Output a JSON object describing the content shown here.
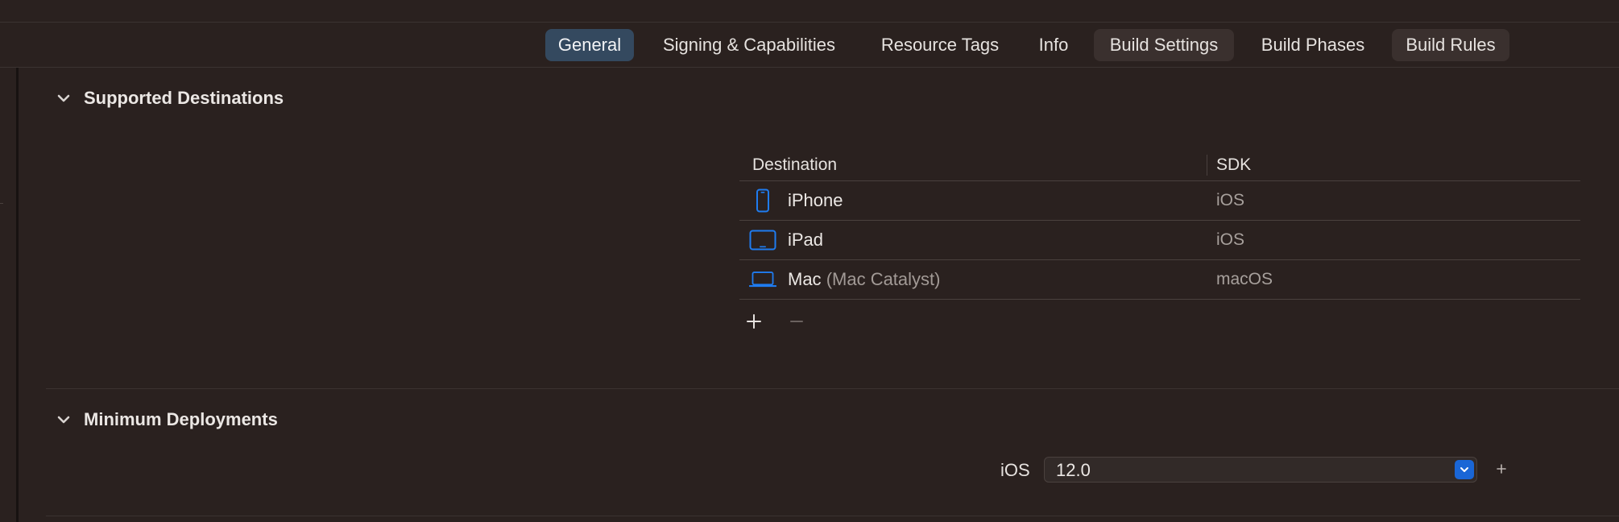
{
  "tabs": [
    {
      "label": "General",
      "active": true
    },
    {
      "label": "Signing & Capabilities",
      "active": false
    },
    {
      "label": "Resource Tags",
      "active": false
    },
    {
      "label": "Info",
      "active": false
    },
    {
      "label": "Build Settings",
      "active": false
    },
    {
      "label": "Build Phases",
      "active": false
    },
    {
      "label": "Build Rules",
      "active": false
    }
  ],
  "supported_destinations": {
    "title": "Supported Destinations",
    "columns": {
      "destination": "Destination",
      "sdk": "SDK"
    },
    "rows": [
      {
        "name": "iPhone",
        "subtitle": "",
        "sdk": "iOS",
        "icon": "iphone-icon"
      },
      {
        "name": "iPad",
        "subtitle": "",
        "sdk": "iOS",
        "icon": "ipad-icon"
      },
      {
        "name": "Mac",
        "subtitle": "(Mac Catalyst)",
        "sdk": "macOS",
        "icon": "laptop-icon"
      }
    ],
    "actions": {
      "add": "+",
      "remove": "−"
    }
  },
  "minimum_deployments": {
    "title": "Minimum Deployments",
    "platform_label": "iOS",
    "version": "12.0"
  },
  "colors": {
    "background": "#2a211f",
    "accent": "#1a66d6",
    "active_tab": "#34495f",
    "device_icon": "#1f7cf0"
  }
}
